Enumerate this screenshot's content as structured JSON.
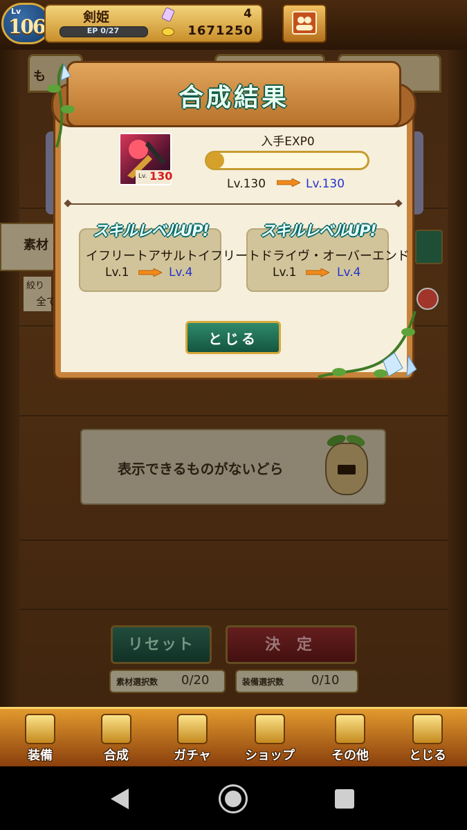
{
  "header": {
    "level_small": "Lv",
    "level": "106",
    "player_name": "剣姫",
    "ep": "EP 0/27",
    "gems": "4",
    "coins": "1671250"
  },
  "background": {
    "tab_label": "も",
    "material_label": "素材",
    "filter_label": "絞り",
    "filter_value": "全て",
    "empty_message": "表示できるものがないどら",
    "reset_label": "リセット",
    "decide_label": "決 定",
    "material_count_label": "素材選択数",
    "material_count": "0/20",
    "equip_count_label": "装備選択数",
    "equip_count": "0/10"
  },
  "modal": {
    "title": "合成結果",
    "exp_label": "入手EXP0",
    "char_level_small": "Lv.",
    "char_level": "130",
    "level_before": "Lv.130",
    "level_after": "Lv.130",
    "exp_fill": 0,
    "skills": [
      {
        "badge": "スキルレベルUP!",
        "name": "イフリートアサルト",
        "lv_before": "Lv.1",
        "lv_after": "Lv.4"
      },
      {
        "badge": "スキルレベルUP!",
        "name": "イフリートドライヴ・オーバーエンド",
        "lv_before": "Lv.1",
        "lv_after": "Lv.4"
      }
    ],
    "close_label": "とじる"
  },
  "nav": [
    {
      "label": "装備",
      "icon": "equipment-icon"
    },
    {
      "label": "合成",
      "icon": "hammer-icon"
    },
    {
      "label": "ガチャ",
      "icon": "gacha-icon"
    },
    {
      "label": "ショップ",
      "icon": "shop-crystal-icon"
    },
    {
      "label": "その他",
      "icon": "gear-icon"
    },
    {
      "label": "とじる",
      "icon": "close-nav-icon"
    }
  ],
  "colors": {
    "accent_green": "#14553f",
    "level_up_blue": "#2233cc",
    "arrow_orange": "#f08a1c"
  }
}
